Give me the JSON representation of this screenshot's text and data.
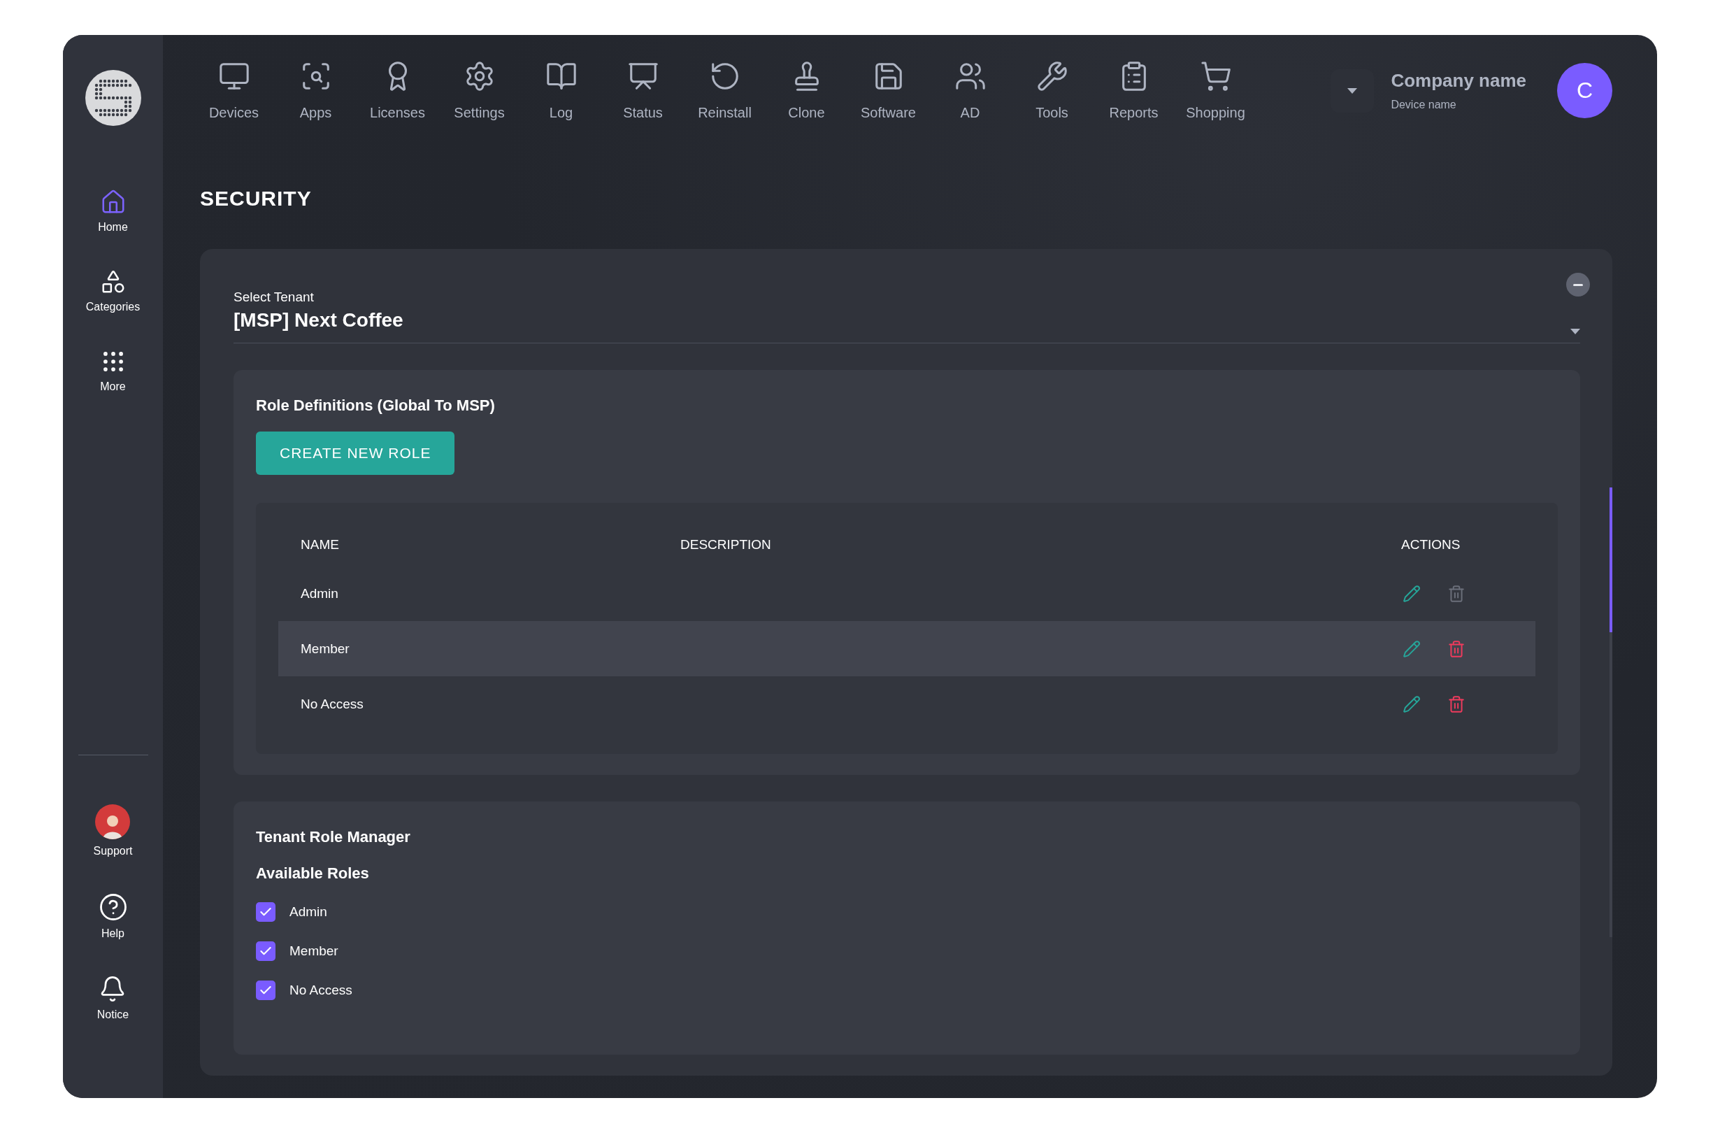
{
  "sidebar": {
    "items": [
      {
        "label": "Home",
        "selected": true
      },
      {
        "label": "Categories",
        "selected": false
      },
      {
        "label": "More",
        "selected": false
      }
    ],
    "bottom_items": [
      {
        "label": "Support",
        "kind": "avatar"
      },
      {
        "label": "Help",
        "kind": "help"
      },
      {
        "label": "Notice",
        "kind": "bell"
      }
    ]
  },
  "toolbar": [
    {
      "label": "Devices"
    },
    {
      "label": "Apps"
    },
    {
      "label": "Licenses"
    },
    {
      "label": "Settings"
    },
    {
      "label": "Log"
    },
    {
      "label": "Status"
    },
    {
      "label": "Reinstall"
    },
    {
      "label": "Clone"
    },
    {
      "label": "Software"
    },
    {
      "label": "AD"
    },
    {
      "label": "Tools"
    },
    {
      "label": "Reports"
    },
    {
      "label": "Shopping"
    }
  ],
  "account": {
    "company": "Company name",
    "device": "Device name",
    "avatar_letter": "C"
  },
  "page_title": "SECURITY",
  "tenant": {
    "label": "Select Tenant",
    "value": "[MSP] Next Coffee"
  },
  "role_definitions": {
    "title": "Role Definitions (Global To MSP)",
    "button": "CREATE NEW ROLE",
    "columns": [
      "NAME",
      "DESCRIPTION",
      "ACTIONS"
    ],
    "rows": [
      {
        "name": "Admin",
        "highlighted": false,
        "delete_disabled": true
      },
      {
        "name": "Member",
        "highlighted": true,
        "delete_disabled": false
      },
      {
        "name": "No Access",
        "highlighted": false,
        "delete_disabled": false
      }
    ]
  },
  "tenant_role_manager": {
    "title": "Tenant Role Manager",
    "subtitle": "Available Roles",
    "roles": [
      {
        "label": "Admin",
        "checked": true
      },
      {
        "label": "Member",
        "checked": true
      },
      {
        "label": "No Access",
        "checked": true
      }
    ]
  }
}
